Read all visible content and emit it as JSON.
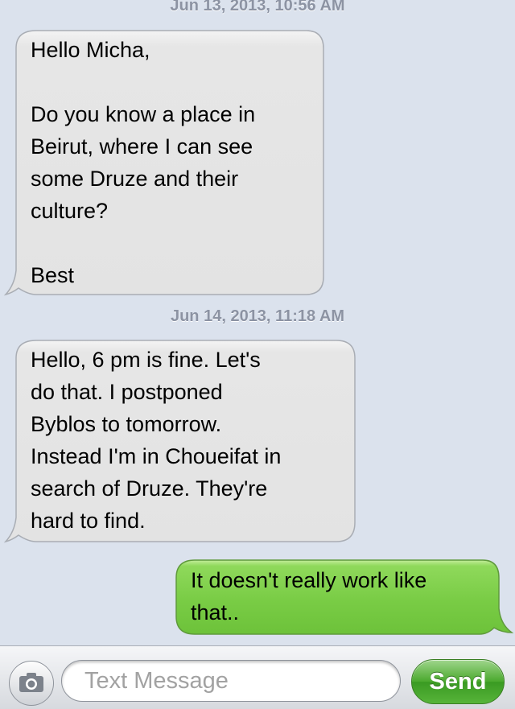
{
  "conversation": {
    "messages": [
      {
        "timestamp": "Jun 13, 2013, 10:56 AM",
        "direction": "received",
        "text": "Hello Micha,\n\nDo you know a place in\nBeirut, where I can see\nsome Druze and their\nculture?\n\nBest"
      },
      {
        "timestamp": "Jun 14, 2013, 11:18 AM",
        "direction": "received",
        "text": "Hello, 6 pm is fine. Let's\ndo that. I postponed\nByblos to tomorrow.\nInstead I'm in Choueifat in\nsearch of Druze. They're\nhard to find."
      },
      {
        "direction": "sent",
        "text": "It doesn't really work like\nthat.."
      }
    ]
  },
  "composer": {
    "camera_icon": "camera-icon",
    "placeholder": "Text Message",
    "value": "",
    "send_label": "Send"
  },
  "colors": {
    "background": "#dbe2ed",
    "received_bubble": "#e5e5ea",
    "sent_bubble": "#7ed04b",
    "timestamp_text": "#8c93a3"
  }
}
